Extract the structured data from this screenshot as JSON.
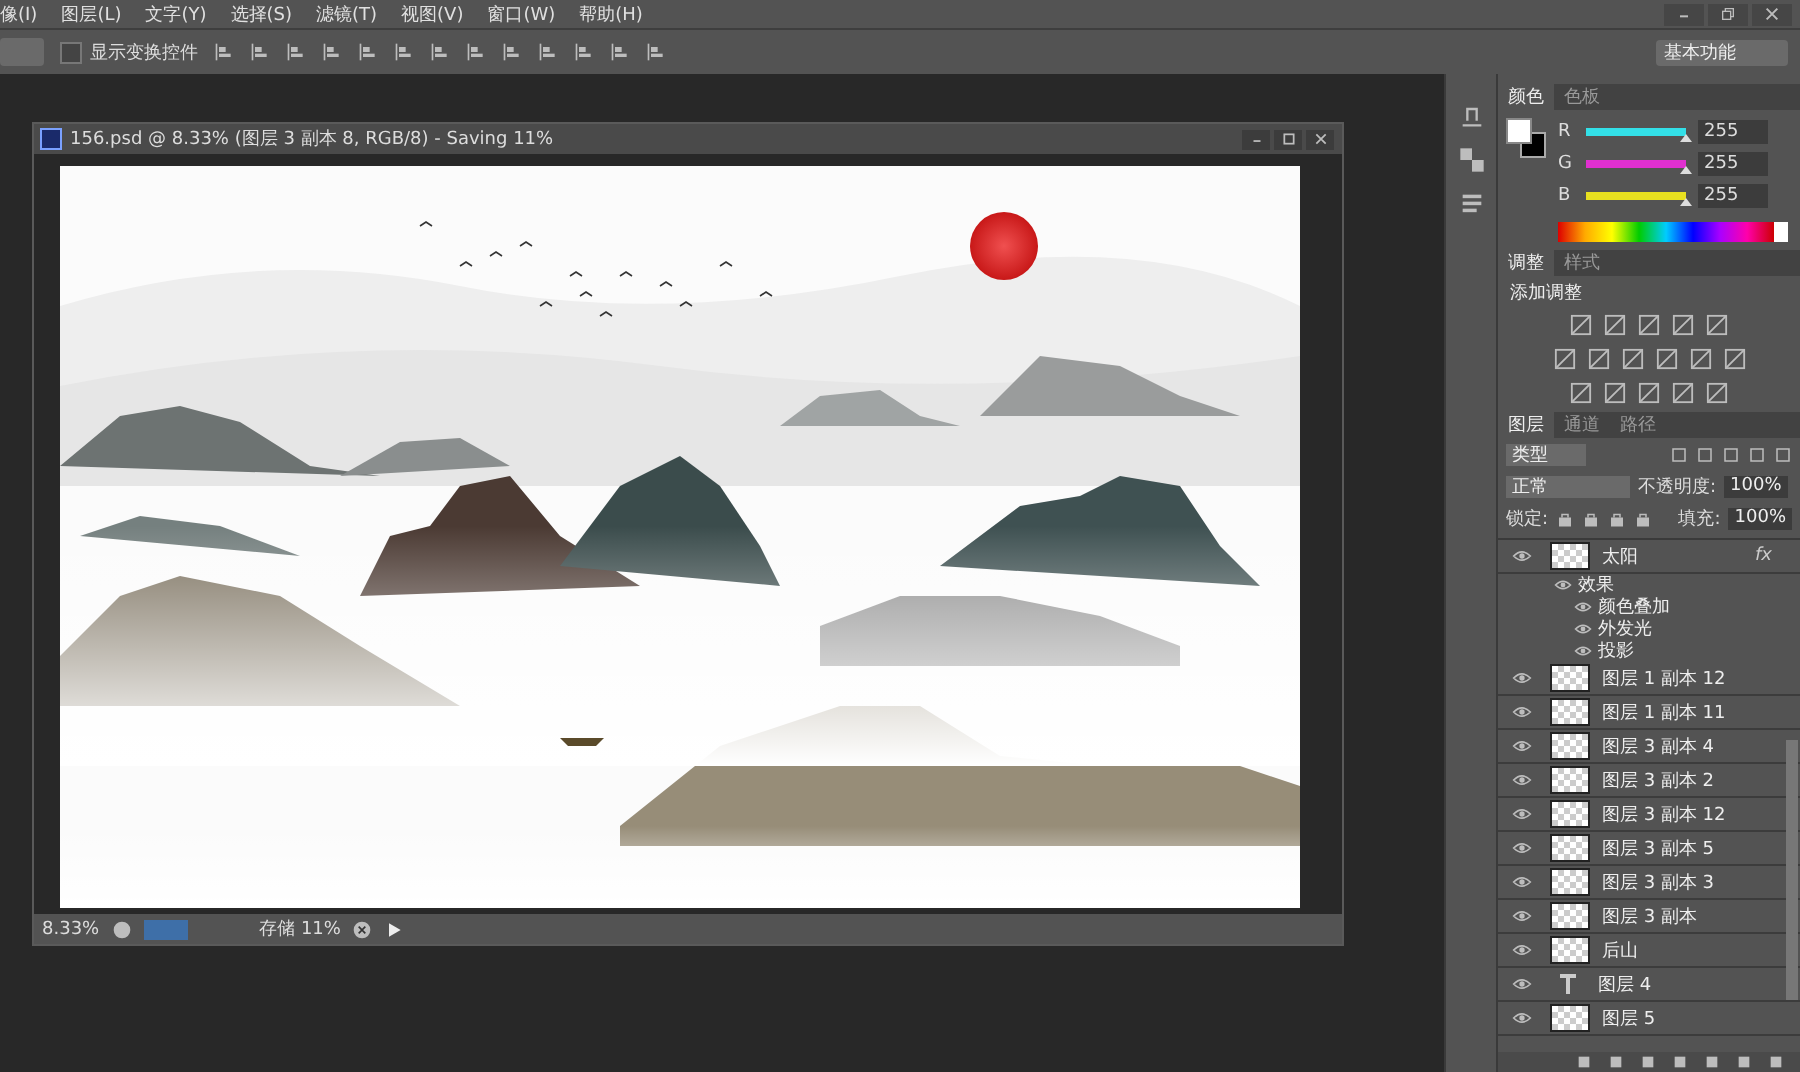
{
  "menu": [
    {
      "label": "像(I)"
    },
    {
      "label": "图层(L)"
    },
    {
      "label": "文字(Y)"
    },
    {
      "label": "选择(S)"
    },
    {
      "label": "滤镜(T)"
    },
    {
      "label": "视图(V)"
    },
    {
      "label": "窗口(W)"
    },
    {
      "label": "帮助(H)"
    }
  ],
  "options": {
    "show_transform_controls": {
      "label": "显示变换控件",
      "checked": false
    },
    "workspace": "基本功能"
  },
  "document": {
    "title": "156.psd @ 8.33% (图层 3 副本 8, RGB/8) - Saving 11%",
    "zoom": "8.33%",
    "status": "存储 11%"
  },
  "color_panel": {
    "tabs": [
      {
        "label": "颜色",
        "selected": true
      },
      {
        "label": "色板",
        "selected": false
      }
    ],
    "channels": [
      {
        "name": "R",
        "value": "255",
        "level": 1,
        "color": "#33e0e8"
      },
      {
        "name": "G",
        "value": "255",
        "level": 1,
        "color": "#e030d0"
      },
      {
        "name": "B",
        "value": "255",
        "level": 1,
        "color": "#e8e020"
      }
    ]
  },
  "adjustments_panel": {
    "tabs": [
      {
        "label": "调整",
        "selected": true
      },
      {
        "label": "样式",
        "selected": false
      }
    ],
    "heading": "添加调整"
  },
  "layers_panel": {
    "tabs": [
      {
        "label": "图层",
        "selected": true
      },
      {
        "label": "通道",
        "selected": false
      },
      {
        "label": "路径",
        "selected": false
      }
    ],
    "filter": "类型",
    "blend_mode": "正常",
    "opacity_label": "不透明度:",
    "opacity": "100%",
    "lock_label": "锁定:",
    "fill_label": "填充:",
    "fill": "100%",
    "layers": [
      {
        "name": "太阳",
        "kind": "pixel",
        "visible": true,
        "fx": "fx",
        "expanded": true,
        "effects_label": "效果",
        "effects": [
          {
            "name": "颜色叠加",
            "visible": true
          },
          {
            "name": "外发光",
            "visible": true
          },
          {
            "name": "投影",
            "visible": true
          }
        ]
      },
      {
        "name": "图层 1 副本 12",
        "kind": "pixel",
        "visible": true
      },
      {
        "name": "图层 1 副本 11",
        "kind": "pixel",
        "visible": true
      },
      {
        "name": "图层 3 副本 4",
        "kind": "pixel",
        "visible": true
      },
      {
        "name": "图层 3 副本 2",
        "kind": "pixel",
        "visible": true
      },
      {
        "name": "图层 3 副本 12",
        "kind": "pixel",
        "visible": true
      },
      {
        "name": "图层 3 副本 5",
        "kind": "pixel",
        "visible": true
      },
      {
        "name": "图层 3 副本 3",
        "kind": "pixel",
        "visible": true
      },
      {
        "name": "图层 3 副本",
        "kind": "pixel",
        "visible": true
      },
      {
        "name": "后山",
        "kind": "pixel",
        "visible": true
      },
      {
        "name": "图层 4",
        "kind": "text",
        "visible": true
      },
      {
        "name": "图层 5",
        "kind": "pixel",
        "visible": true
      }
    ]
  }
}
